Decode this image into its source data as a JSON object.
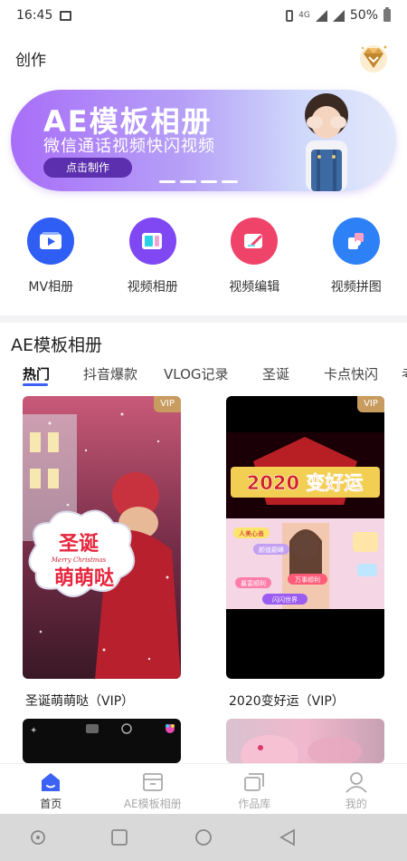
{
  "status_bar": {
    "time": "16:45",
    "battery_percent": "50%",
    "network": "4G"
  },
  "header": {
    "title": "创作",
    "vip_icon": "crown-diamond-icon"
  },
  "banner": {
    "title": "AE模板相册",
    "subtitle": "微信通话视频快闪视频",
    "button_label": "点击制作",
    "slide_count": 4
  },
  "quick_menu": [
    {
      "label": "MV相册",
      "icon": "video-play-icon",
      "color": "#2f5ef5"
    },
    {
      "label": "视频相册",
      "icon": "photo-album-icon",
      "color": "#8048f3"
    },
    {
      "label": "视频编辑",
      "icon": "edit-pen-icon",
      "color": "#f0436a"
    },
    {
      "label": "视频拼图",
      "icon": "puzzle-icon",
      "color": "#2e80f6"
    }
  ],
  "section": {
    "title": "AE模板相册",
    "tabs": [
      "热门",
      "抖音爆款",
      "VLOG记录",
      "圣诞",
      "卡点快闪",
      "考"
    ],
    "active_tab": 0
  },
  "cards": [
    {
      "title": "圣诞萌萌哒（VIP）",
      "badge": "VIP",
      "overlay_text_1": "圣诞",
      "overlay_text_2": "萌萌哒",
      "overlay_small": "Merry Christmas"
    },
    {
      "title": "2020变好运（VIP）",
      "badge": "VIP",
      "overlay_text_1": "2020 变好运",
      "stickers": [
        "人美心善",
        "颜值巅峰",
        "万事顺利",
        "暴富顺利",
        "闪闪世界"
      ]
    }
  ],
  "bottom_nav": [
    {
      "label": "首页",
      "icon": "home-icon",
      "active": true
    },
    {
      "label": "AE模板相册",
      "icon": "template-box-icon",
      "active": false
    },
    {
      "label": "作品库",
      "icon": "works-stack-icon",
      "active": false
    },
    {
      "label": "我的",
      "icon": "user-icon",
      "active": false
    }
  ]
}
